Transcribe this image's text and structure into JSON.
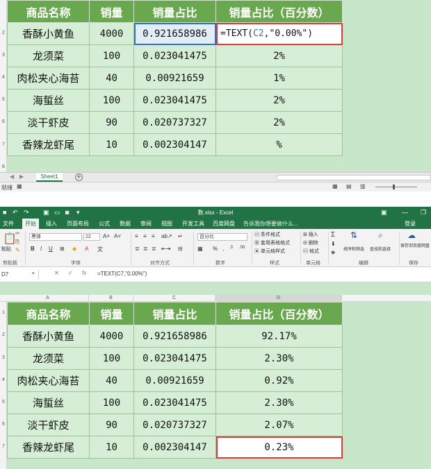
{
  "top": {
    "row_numbers": [
      "2",
      "3",
      "4",
      "5",
      "6",
      "7",
      "8"
    ],
    "headers": [
      "商品名称",
      "销量",
      "销量占比",
      "销量占比（百分数）"
    ],
    "rows": [
      {
        "name": "香酥小黄鱼",
        "qty": "4000",
        "ratio": "0.921658986",
        "pct": ""
      },
      {
        "name": "龙须菜",
        "qty": "100",
        "ratio": "0.023041475",
        "pct": "2%"
      },
      {
        "name": "肉松夹心海苔",
        "qty": "40",
        "ratio": "0.00921659",
        "pct": "1%"
      },
      {
        "name": "海蜇丝",
        "qty": "100",
        "ratio": "0.023041475",
        "pct": "2%"
      },
      {
        "name": "淡干虾皮",
        "qty": "90",
        "ratio": "0.020737327",
        "pct": "2%"
      },
      {
        "name": "香辣龙虾尾",
        "qty": "10",
        "ratio": "0.002304147",
        "pct": "%"
      }
    ],
    "formula_prefix": "=TEXT(",
    "formula_ref": "C2",
    "formula_suffix": ",\"0.00%\")",
    "sheet_tab": "Sheet1",
    "status_left": "就绪"
  },
  "bottom": {
    "window_title": "数.xlsx - Excel",
    "menu": [
      "文件",
      "开始",
      "插入",
      "页面布局",
      "公式",
      "数据",
      "审阅",
      "视图",
      "开发工具",
      "百度网盘"
    ],
    "tell_me": "告诉我你想要做什么...",
    "login": "登录",
    "ribbon": {
      "paste": "粘贴",
      "clipboard": "剪贴板",
      "font_name": "黑体",
      "font_size": "22",
      "font_group": "字体",
      "align_group": "对齐方式",
      "number_format": "百分比",
      "number_group": "数字",
      "cond_format": "条件格式",
      "table_format": "套用表格格式",
      "cell_style": "单元格样式",
      "style_group": "样式",
      "insert": "插入",
      "delete": "删除",
      "format": "格式",
      "cells_group": "单元格",
      "sort_filter": "排序和筛选",
      "find_select": "查找和选择",
      "edit_group": "编辑",
      "save_baidu": "保存到百度网盘",
      "save_group": "保存"
    },
    "name_box": "D7",
    "formula": "=TEXT(C7,\"0.00%\")",
    "col_headers": [
      "A",
      "B",
      "C",
      "D"
    ],
    "row_numbers": [
      "1",
      "2",
      "3",
      "4",
      "5",
      "6",
      "7"
    ],
    "headers": [
      "商品名称",
      "销量",
      "销量占比",
      "销量占比（百分数）"
    ],
    "rows": [
      {
        "name": "香酥小黄鱼",
        "qty": "4000",
        "ratio": "0.921658986",
        "pct": "92.17%"
      },
      {
        "name": "龙须菜",
        "qty": "100",
        "ratio": "0.023041475",
        "pct": "2.30%"
      },
      {
        "name": "肉松夹心海苔",
        "qty": "40",
        "ratio": "0.00921659",
        "pct": "0.92%"
      },
      {
        "name": "海蜇丝",
        "qty": "100",
        "ratio": "0.023041475",
        "pct": "2.30%"
      },
      {
        "name": "淡干虾皮",
        "qty": "90",
        "ratio": "0.020737327",
        "pct": "2.07%"
      },
      {
        "name": "香辣龙虾尾",
        "qty": "10",
        "ratio": "0.002304147",
        "pct": "0.23%"
      }
    ]
  },
  "colors": {
    "header_green": "#6aa84f",
    "cell_green": "#d5eed5",
    "excel_green": "#217346",
    "highlight_red": "#e53935",
    "highlight_blue": "#2f6fbf"
  }
}
